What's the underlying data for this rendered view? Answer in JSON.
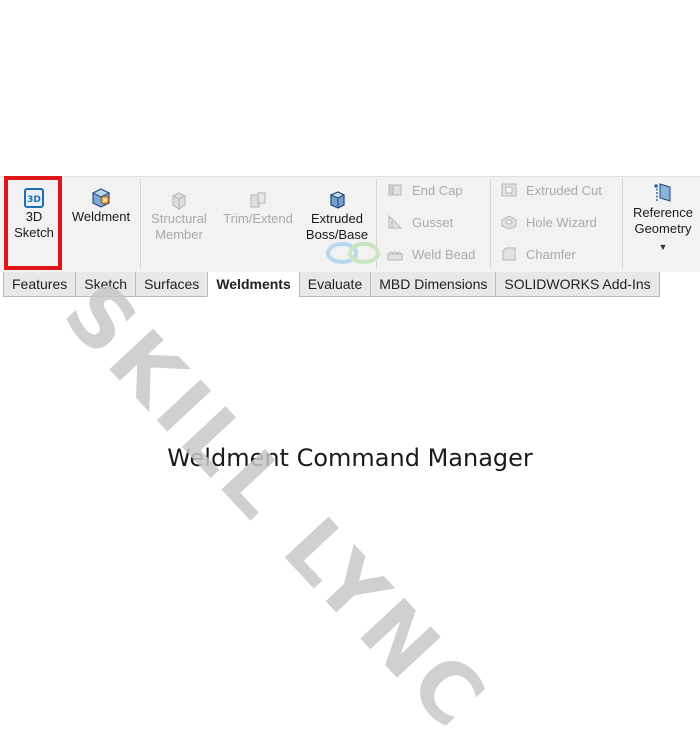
{
  "caption": "Weldment Command Manager",
  "watermark": "SKILL LYNC",
  "colors": {
    "highlight": "#e0141b",
    "ribbon_bg": "#f2f2f2",
    "disabled_text": "#a9a9a9",
    "accent_blue": "#1f6fb2"
  },
  "ribbon": {
    "sketch3d": {
      "label": "3D\nSketch",
      "icon": "sketch-3d-icon"
    },
    "weldment": {
      "label": "Weldment",
      "icon": "weldment-icon"
    },
    "structural_member": {
      "label": "Structural\nMember",
      "icon": "structural-member-icon"
    },
    "trim_extend": {
      "label": "Trim/Extend",
      "icon": "trim-extend-icon"
    },
    "extruded_boss": {
      "label": "Extruded\nBoss/Base",
      "icon": "extruded-boss-icon"
    },
    "end_cap": {
      "label": "End Cap",
      "icon": "end-cap-icon"
    },
    "gusset": {
      "label": "Gusset",
      "icon": "gusset-icon"
    },
    "weld_bead": {
      "label": "Weld Bead",
      "icon": "weld-bead-icon"
    },
    "extruded_cut": {
      "label": "Extruded Cut",
      "icon": "extruded-cut-icon"
    },
    "hole_wizard": {
      "label": "Hole Wizard",
      "icon": "hole-wizard-icon"
    },
    "chamfer": {
      "label": "Chamfer",
      "icon": "chamfer-icon"
    },
    "reference_geometry": {
      "label": "Reference\nGeometry",
      "icon": "reference-geometry-icon"
    }
  },
  "tabs": [
    {
      "label": "Features",
      "active": false
    },
    {
      "label": "Sketch",
      "active": false
    },
    {
      "label": "Surfaces",
      "active": false
    },
    {
      "label": "Weldments",
      "active": true
    },
    {
      "label": "Evaluate",
      "active": false
    },
    {
      "label": "MBD Dimensions",
      "active": false
    },
    {
      "label": "SOLIDWORKS Add-Ins",
      "active": false
    }
  ]
}
